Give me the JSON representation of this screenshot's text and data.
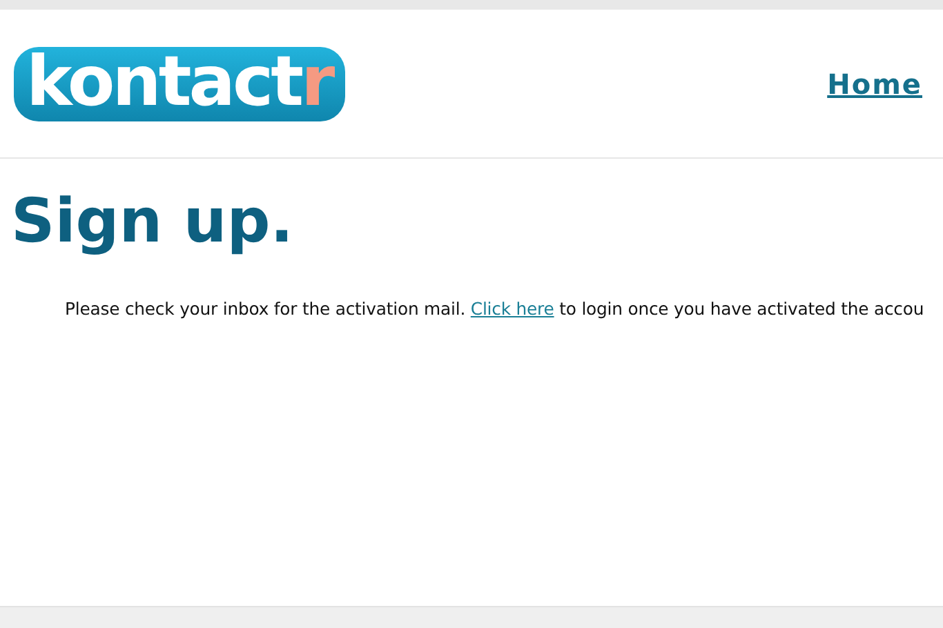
{
  "header": {
    "logo": {
      "main": "kontact",
      "accent": "r"
    },
    "nav": [
      {
        "label": "Home"
      }
    ]
  },
  "title": "Sign up.",
  "message": {
    "before": "Please check your inbox for the activation mail.",
    "link": "Click here",
    "after": "to login once you have activated the accou"
  }
}
